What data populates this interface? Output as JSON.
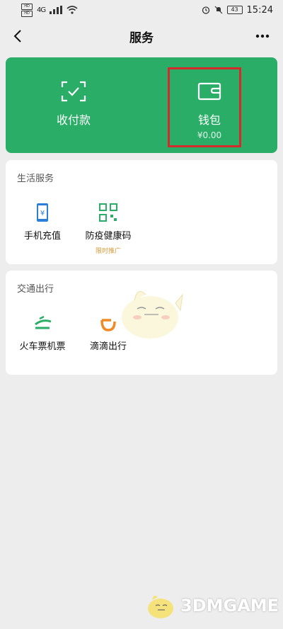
{
  "status_bar": {
    "time": "15:24",
    "signal": "4G",
    "battery": "43"
  },
  "nav": {
    "title": "服务"
  },
  "green_card": {
    "pay": {
      "label": "收付款"
    },
    "wallet": {
      "label": "钱包",
      "balance": "¥0.00"
    }
  },
  "life_services": {
    "title": "生活服务",
    "items": [
      {
        "label": "手机充值"
      },
      {
        "label": "防疫健康码",
        "sub": "限时推广"
      }
    ]
  },
  "transport": {
    "title": "交通出行",
    "items": [
      {
        "label": "火车票机票"
      },
      {
        "label": "滴滴出行"
      }
    ]
  },
  "watermark": {
    "text": "3DMGAME"
  },
  "colors": {
    "brand_green": "#2aae67",
    "highlight_red": "#d6292b",
    "promo_orange": "#d49a3a"
  }
}
